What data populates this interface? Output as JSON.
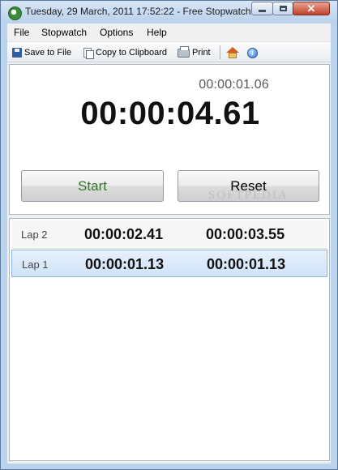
{
  "window": {
    "title": "Tuesday, 29 March, 2011 17:52:22 - Free Stopwatch"
  },
  "menu": {
    "items": [
      {
        "label": "File"
      },
      {
        "label": "Stopwatch"
      },
      {
        "label": "Options"
      },
      {
        "label": "Help"
      }
    ]
  },
  "toolbar": {
    "save_label": "Save to File",
    "copy_label": "Copy to Clipboard",
    "print_label": "Print"
  },
  "display": {
    "lap_time": "00:00:01.06",
    "main_time": "00:00:04.61"
  },
  "buttons": {
    "start_label": "Start",
    "reset_label": "Reset"
  },
  "watermark": "SOFTPEDIA",
  "laps": [
    {
      "name": "Lap 2",
      "split": "00:00:02.41",
      "total": "00:00:03.55",
      "selected": false
    },
    {
      "name": "Lap 1",
      "split": "00:00:01.13",
      "total": "00:00:01.13",
      "selected": true
    }
  ],
  "colors": {
    "start_text": "#2b7a1e",
    "selection": "#cfe3f8",
    "titlebar": "#b9d1ea"
  }
}
